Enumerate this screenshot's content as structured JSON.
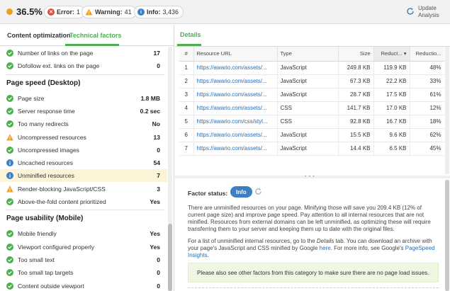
{
  "header": {
    "score": "36.5%",
    "score_color": "#f0a020",
    "errors": {
      "label": "Error:",
      "count": "1",
      "color": "#e04b3a",
      "icon": "close-icon"
    },
    "warnings": {
      "label": "Warning:",
      "count": "41",
      "color": "#f0a020",
      "icon": "warning-icon"
    },
    "info": {
      "label": "Info:",
      "count": "3,436",
      "color": "#3b7fc4",
      "icon": "info-icon"
    },
    "update_label": "Update\nAnalysis"
  },
  "left": {
    "tabs": [
      "Content optimization",
      "Technical factors"
    ],
    "active_tab": 1,
    "accent": "#4caf50",
    "items_top": [
      {
        "label": "Number of links on the page",
        "value": "17",
        "status": "ok"
      },
      {
        "label": "Dofollow ext. links on the page",
        "value": "0",
        "status": "ok"
      }
    ],
    "sections": [
      {
        "title": "Page speed (Desktop)",
        "items": [
          {
            "label": "Page size",
            "value": "1.8 MB",
            "status": "ok"
          },
          {
            "label": "Server response time",
            "value": "0.2 sec",
            "status": "ok"
          },
          {
            "label": "Too many redirects",
            "value": "No",
            "status": "ok"
          },
          {
            "label": "Uncompressed resources",
            "value": "13",
            "status": "warning"
          },
          {
            "label": "Uncompressed images",
            "value": "0",
            "status": "ok"
          },
          {
            "label": "Uncached resources",
            "value": "54",
            "status": "info"
          },
          {
            "label": "Unminified resources",
            "value": "7",
            "status": "info",
            "selected": true
          },
          {
            "label": "Render-blocking JavaScript/CSS",
            "value": "3",
            "status": "warning"
          },
          {
            "label": "Above-the-fold content prioritized",
            "value": "Yes",
            "status": "ok"
          }
        ]
      },
      {
        "title": "Page usability (Mobile)",
        "items": [
          {
            "label": "Mobile friendly",
            "value": "Yes",
            "status": "ok"
          },
          {
            "label": "Viewport configured properly",
            "value": "Yes",
            "status": "ok"
          },
          {
            "label": "Too small text",
            "value": "0",
            "status": "ok"
          },
          {
            "label": "Too small tap targets",
            "value": "0",
            "status": "ok"
          },
          {
            "label": "Content outside viewport",
            "value": "0",
            "status": "ok"
          }
        ]
      }
    ]
  },
  "right": {
    "tab": "Details",
    "columns": [
      "#",
      "Resource URL",
      "Type",
      "Size",
      "Reduct...",
      "Reductio..."
    ],
    "sorted_column": 4,
    "rows": [
      [
        "1",
        "https://awario.com/assets/...",
        "JavaScript",
        "249.8 KB",
        "119.9 KB",
        "48%"
      ],
      [
        "2",
        "https://awario.com/assets/...",
        "JavaScript",
        "67.3 KB",
        "22.2 KB",
        "33%"
      ],
      [
        "3",
        "https://awario.com/assets/...",
        "JavaScript",
        "28.7 KB",
        "17.5 KB",
        "61%"
      ],
      [
        "4",
        "https://awario.com/assets/...",
        "CSS",
        "141.7 KB",
        "17.0 KB",
        "12%"
      ],
      [
        "5",
        "https://awario.com/css/styl...",
        "CSS",
        "92.8 KB",
        "16.7 KB",
        "18%"
      ],
      [
        "6",
        "https://awario.com/assets/...",
        "JavaScript",
        "15.5 KB",
        "9.6 KB",
        "62%"
      ],
      [
        "7",
        "https://awario.com/assets/...",
        "JavaScript",
        "14.4 KB",
        "6.5 KB",
        "45%"
      ]
    ],
    "factor_status_label": "Factor status:",
    "factor_status_value": "Info",
    "paragraph1": "There are unminified resources on your page. Minifying those will save you 209.4 KB (12% of current page size) and improve page speed. Pay attention to all internal resources that are not minified. Resources from external domains can be left unminified, as optimizing these will require transferring them to your server and keeping them up to date with the original files.",
    "p2_a": "For a list of unminified internal resources, go to the ",
    "p2_details": "Details",
    "p2_b": " tab. You can download an archive with your page's JavaScript and CSS minified by Google ",
    "p2_here": "here",
    "p2_c": ". For more info, see Google's ",
    "p2_link": "PageSpeed Insights",
    "p2_d": ".",
    "note": "Please also see other factors from this category to make sure there are no page load issues."
  }
}
